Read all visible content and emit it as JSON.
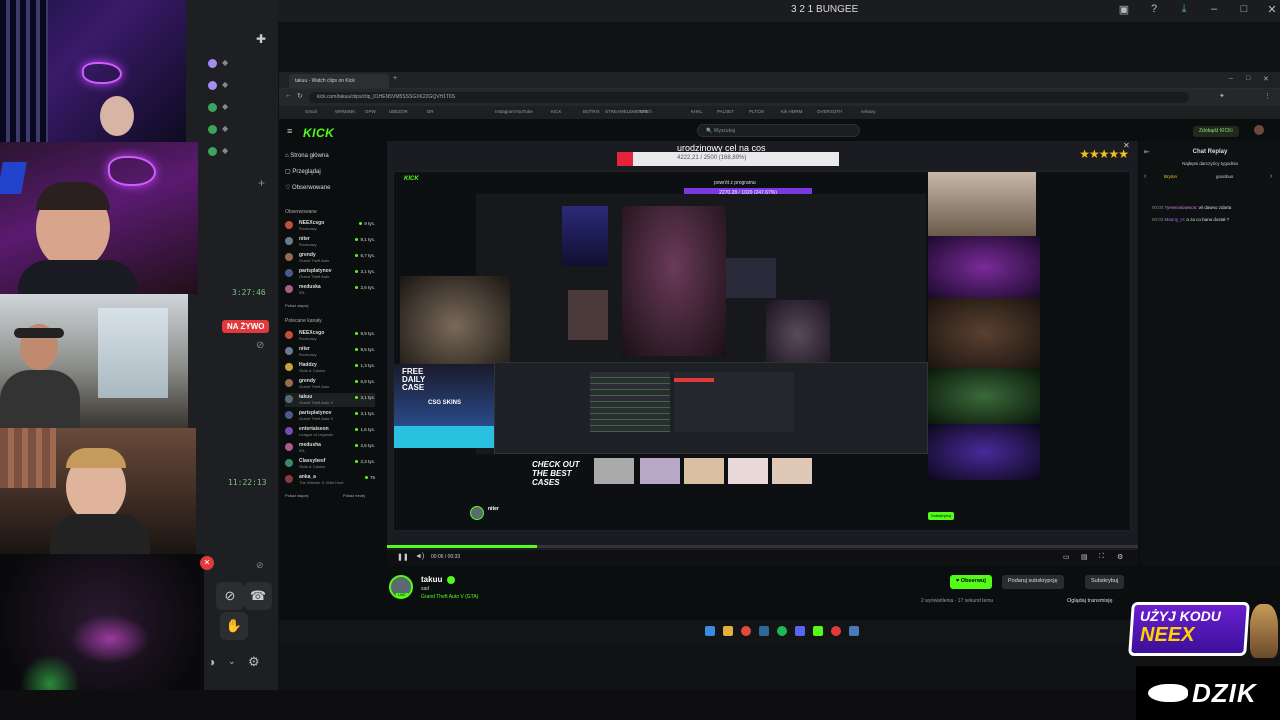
{
  "window": {
    "title": "3 2 1 BUNGEE"
  },
  "discord": {
    "timer1": "3:27:46",
    "live_badge": "NA ŻYWO",
    "timer2": "11:22:13"
  },
  "browser": {
    "tab_title": "takuu - Watch clips on Kick",
    "url": "kick.com/takuu/clips/clip_01HEN5VM5SSSGXK22GQVH1T6S",
    "bookmarks": [
      "Gmail",
      "WRMSBK",
      "GPW",
      "UBEZOR",
      "DR",
      "Instagram",
      "YouTube",
      "KICK",
      "BOTRIX",
      "STREAMELEMENTS",
      "Twitch",
      "KHKL",
      "PALSET",
      "PLTCM",
      "Kik HMRM",
      "OVERSOTH",
      "nehaxy"
    ]
  },
  "kick": {
    "logo": "KICK",
    "search_placeholder": "Wyszukaj",
    "get_kicks": "Zdobądź KICKi",
    "nav": [
      "Strona główna",
      "Przeglądaj",
      "Obserwowane"
    ],
    "followed_header": "Obserwowane",
    "followed": [
      {
        "name": "NEEXcsgo",
        "sub": "Rozmowy",
        "viewers": "9 tys.",
        "color": "#c24f3a"
      },
      {
        "name": "niter",
        "sub": "Rozmowy",
        "viewers": "8,1 tys.",
        "color": "#6b7c8a"
      },
      {
        "name": "grendy",
        "sub": "Grand Theft Auto",
        "viewers": "6,7 tys.",
        "color": "#9a6b4a"
      },
      {
        "name": "parisplatynov",
        "sub": "Grand Theft Auto",
        "viewers": "3,1 tys.",
        "color": "#4a5a8a"
      },
      {
        "name": "meduska",
        "sub": "IRL",
        "viewers": "2,6 tys.",
        "color": "#b05a8a"
      }
    ],
    "show_more": "Pokaż więcej",
    "recommended_header": "Polecane kanały",
    "recommended": [
      {
        "name": "NEEXcsgo",
        "sub": "Rozmowy",
        "viewers": "8,9 tys.",
        "color": "#c24f3a"
      },
      {
        "name": "niter",
        "sub": "Rozmowy",
        "viewers": "8,5 tys.",
        "color": "#6b7c8a"
      },
      {
        "name": "Haddzy",
        "sub": "Slots & Casino",
        "viewers": "1,3 tys.",
        "color": "#c9a23a"
      },
      {
        "name": "grendy",
        "sub": "Grand Theft Auto",
        "viewers": "6,8 tys.",
        "color": "#9a6b4a"
      },
      {
        "name": "takuu",
        "sub": "Grand Theft Auto V",
        "viewers": "3,1 tys.",
        "color": "#5a6a70"
      },
      {
        "name": "parisplatynov",
        "sub": "Grand Theft Auto V",
        "viewers": "3,1 tys.",
        "color": "#4a5a8a"
      },
      {
        "name": "entertaiseon",
        "sub": "League of Legends",
        "viewers": "1,6 tys.",
        "color": "#7a4ab0"
      },
      {
        "name": "medusha",
        "sub": "IRL",
        "viewers": "2,6 tys.",
        "color": "#b05a8a"
      },
      {
        "name": "Classybeef",
        "sub": "Slots & Casino",
        "viewers": "2,3 tys.",
        "color": "#3a8a6a"
      },
      {
        "name": "anka_a",
        "sub": "The Witcher 3: Wild Hunt",
        "viewers": "75",
        "color": "#8a3a3a"
      }
    ],
    "show_more2": "Pokaż więcej",
    "show_less": "Pokaż mniej"
  },
  "video": {
    "overlay_title": "urodzinowy cel na cos",
    "overlay_sub": "4222,21 / 2500 (168,89%)",
    "stars": "★★★★★",
    "inner_goal": "powrót z programu",
    "inner_goal_sub": "2270,28 / 1020 (247,67%)",
    "ad_daily": "FREE DAILY CASE",
    "ad_csgo": "CSG SKINS",
    "ad_check": "CHECK OUT THE BEST CASES",
    "time": "00:06 / 00:33",
    "progress": 0.2
  },
  "streamer": {
    "name": "takuu",
    "title": "sad",
    "category": "Grand Theft Auto V (GTA)",
    "live": "LIVE",
    "follow": "♥ Obserwuj",
    "gift": "Podaruj subskrypcję",
    "subscribe": "Subskrybuj",
    "stats": "2 wyświetlenia · 17 sekund temu",
    "watch": "Oglądaj transmisję"
  },
  "chat": {
    "header": "Chat Replay",
    "pinned": "Najlepsi darczyńcy tygodnia",
    "donor1": "Bryton",
    "donor2": "goonbus",
    "messages": [
      {
        "time": "00:00",
        "user": "TyHenoslawson",
        "text": "wl dawno zdarta",
        "color": "#d77be0"
      },
      {
        "time": "00:03",
        "user": "Manny_H",
        "text": "a za co bana dostał ?",
        "color": "#9e7bff"
      }
    ]
  },
  "ads": {
    "code_line1": "UŻYJ KODU",
    "code_line2": "NEEX",
    "brand": "DZIK"
  }
}
